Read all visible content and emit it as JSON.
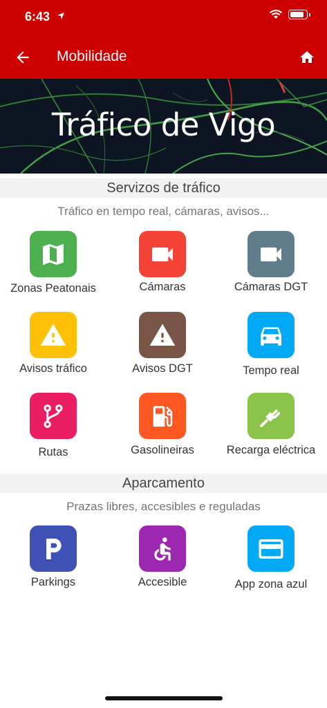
{
  "status": {
    "time": "6:43"
  },
  "nav": {
    "title": "Mobilidade"
  },
  "hero": {
    "title": "Tráfico de Vigo"
  },
  "sections": [
    {
      "title": "Servizos de tráfico",
      "subtitle": "Tráfico en tempo real, cámaras, avisos...",
      "items": [
        {
          "label": "Zonas Peatonais",
          "icon": "map-icon",
          "color": "#4caf50"
        },
        {
          "label": "Cámaras",
          "icon": "videocam-icon",
          "color": "#f44336"
        },
        {
          "label": "Cámaras DGT",
          "icon": "videocam-icon",
          "color": "#607d8b"
        },
        {
          "label": "Avisos tráfico",
          "icon": "warning-icon",
          "color": "#ffc107"
        },
        {
          "label": "Avisos DGT",
          "icon": "warning-icon",
          "color": "#795548"
        },
        {
          "label": "Tempo real",
          "icon": "car-icon",
          "color": "#03a9f4"
        },
        {
          "label": "Rutas",
          "icon": "fork-icon",
          "color": "#e91e63"
        },
        {
          "label": "Gasolineiras",
          "icon": "gas-station-icon",
          "color": "#ff5722"
        },
        {
          "label": "Recarga eléctrica",
          "icon": "plug-icon",
          "color": "#8bc34a"
        }
      ]
    },
    {
      "title": "Aparcamento",
      "subtitle": "Prazas libres, accesibles e reguladas",
      "items": [
        {
          "label": "Parkings",
          "icon": "parking-icon",
          "color": "#3f51b5"
        },
        {
          "label": "Accesible",
          "icon": "accessible-icon",
          "color": "#9c27b0"
        },
        {
          "label": "App zona azul",
          "icon": "card-icon",
          "color": "#03a9f4"
        }
      ]
    }
  ]
}
